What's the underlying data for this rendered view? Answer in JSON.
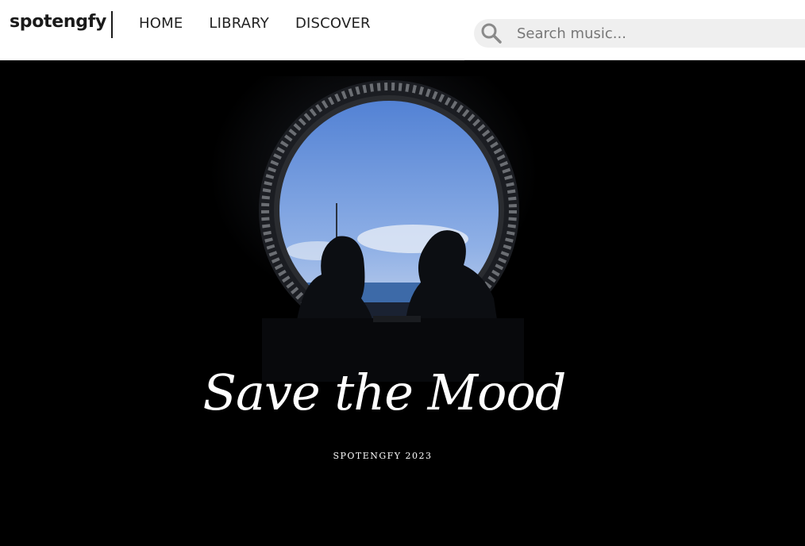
{
  "brand": {
    "name": "spotengfy"
  },
  "nav": {
    "items": [
      {
        "label": "HOME"
      },
      {
        "label": "LIBRARY"
      },
      {
        "label": "DISCOVER"
      }
    ]
  },
  "search": {
    "placeholder": "Search music...",
    "value": "",
    "icon": "search-icon"
  },
  "hero": {
    "title": "Save the Mood",
    "subtitle": "SPOTENGFY 2023",
    "image": "couple-silhouette-porthole-ocean"
  },
  "colors": {
    "nav_bg": "#ffffff",
    "page_bg": "#000000",
    "search_bg": "#efefef",
    "text_dark": "#1a1a1a",
    "sky": "#5b86d6"
  }
}
